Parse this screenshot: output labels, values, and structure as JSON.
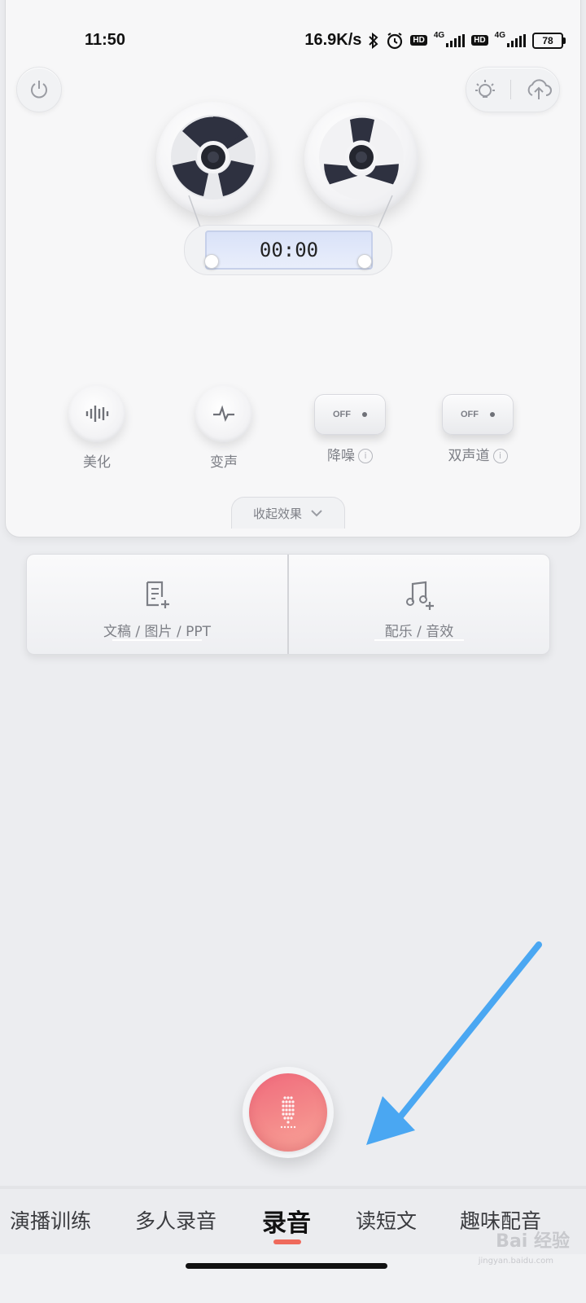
{
  "status_bar": {
    "time": "11:50",
    "network_speed": "16.9K/s",
    "sim1_hd": "HD",
    "sim1_net": "4G",
    "sim2_hd": "HD",
    "sim2_net": "4G",
    "battery": "78"
  },
  "recorder": {
    "timer": "00:00",
    "icons": [
      "power-icon",
      "lightbulb-icon",
      "cloud-upload-icon"
    ]
  },
  "effects": [
    {
      "label": "美化",
      "type": "button",
      "icon": "waveform-icon"
    },
    {
      "label": "变声",
      "type": "button",
      "icon": "pulse-icon"
    },
    {
      "label": "降噪",
      "type": "toggle",
      "state": "OFF",
      "info": "i"
    },
    {
      "label": "双声道",
      "type": "toggle",
      "state": "OFF",
      "info": "i"
    }
  ],
  "collapse_label": "收起效果",
  "tools": [
    {
      "label": "文稿 / 图片 / PPT",
      "icon": "document-add-icon"
    },
    {
      "label": "配乐 / 音效",
      "icon": "music-add-icon"
    }
  ],
  "tabs": [
    {
      "label": "演播训练",
      "active": false
    },
    {
      "label": "多人录音",
      "active": false
    },
    {
      "label": "录音",
      "active": true
    },
    {
      "label": "读短文",
      "active": false
    },
    {
      "label": "趣味配音",
      "active": false
    }
  ],
  "colors": {
    "accent": "#ef6a5c",
    "record_button": "#f27a84",
    "annotation_arrow": "#4aa7f2"
  },
  "watermark": {
    "text": "Bai 经验",
    "sub": "jingyan.baidu.com"
  }
}
